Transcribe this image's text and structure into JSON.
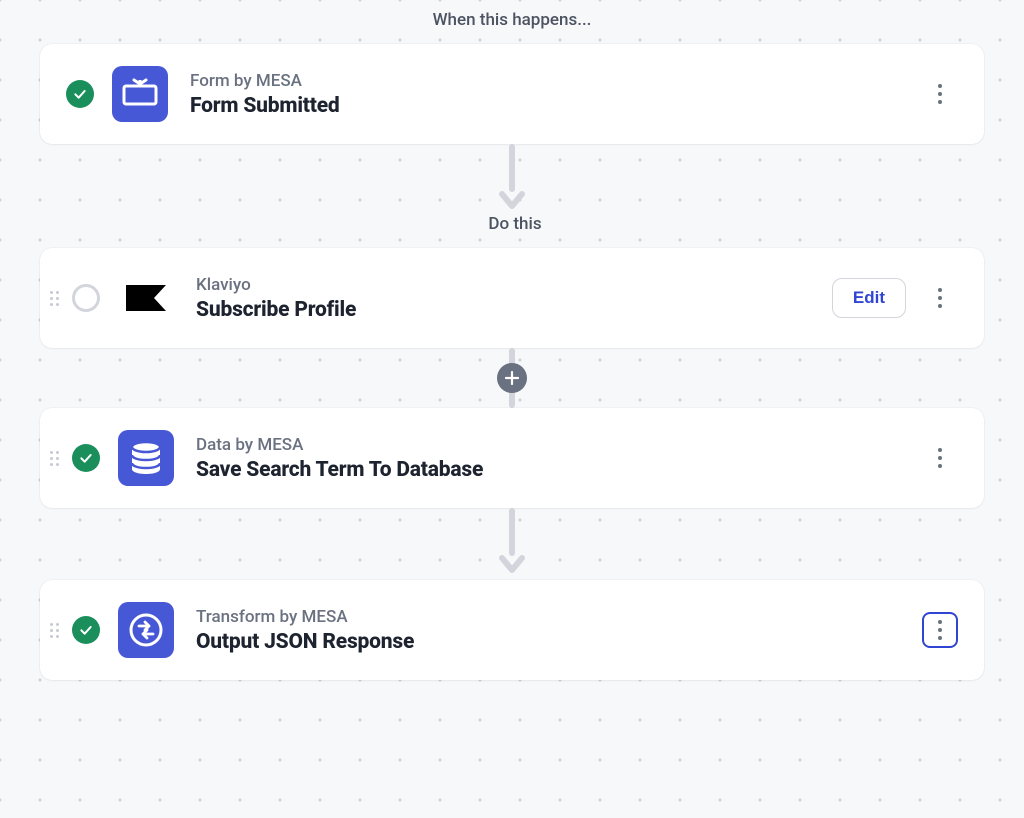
{
  "labels": {
    "trigger": "When this happens...",
    "actions": "Do this"
  },
  "buttons": {
    "edit": "Edit"
  },
  "steps": [
    {
      "provider": "Form by MESA",
      "title": "Form Submitted",
      "status": "done",
      "icon": "form",
      "iconColor": "indigo",
      "hasDrag": false,
      "showEdit": false,
      "kebabFocused": false
    },
    {
      "provider": "Klaviyo",
      "title": "Subscribe Profile",
      "status": "empty",
      "icon": "klaviyo",
      "iconColor": "white",
      "hasDrag": true,
      "showEdit": true,
      "kebabFocused": false
    },
    {
      "provider": "Data by MESA",
      "title": "Save Search Term To Database",
      "status": "done",
      "icon": "database",
      "iconColor": "indigo",
      "hasDrag": true,
      "showEdit": false,
      "kebabFocused": false
    },
    {
      "provider": "Transform by MESA",
      "title": "Output JSON Response",
      "status": "done",
      "icon": "transform",
      "iconColor": "indigo",
      "hasDrag": true,
      "showEdit": false,
      "kebabFocused": true
    }
  ]
}
